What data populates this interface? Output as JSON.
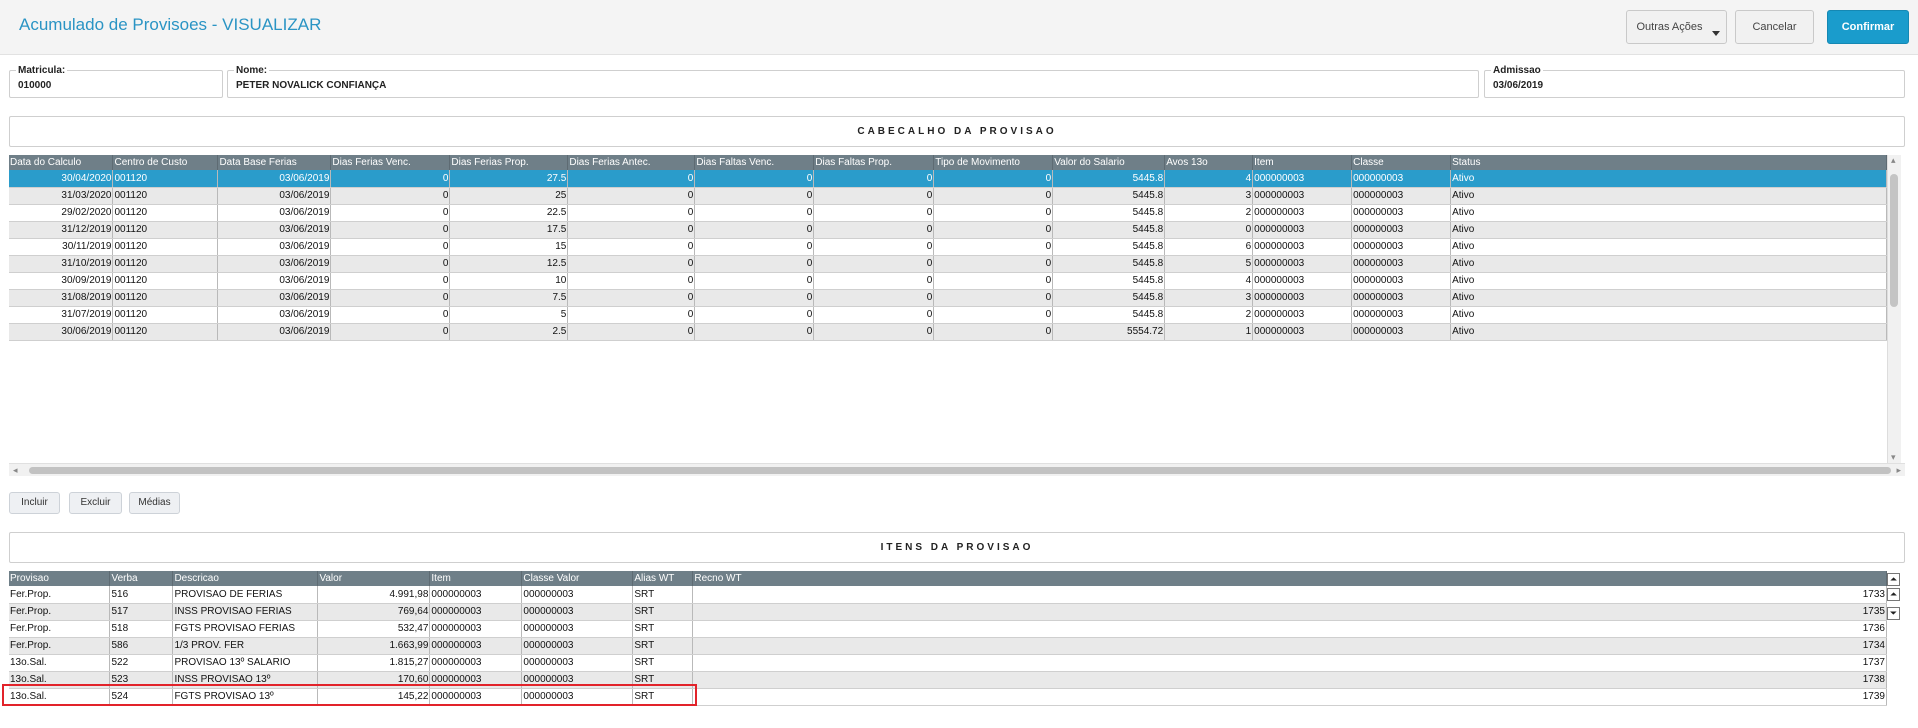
{
  "header": {
    "title": "Acumulado de Provisoes - VISUALIZAR",
    "outras_acoes": "Outras Ações",
    "cancelar": "Cancelar",
    "confirmar": "Confirmar"
  },
  "fields": {
    "matricula_label": "Matricula:",
    "matricula_value": "010000",
    "nome_label": "Nome:",
    "nome_value": "PETER NOVALICK CONFIANÇA",
    "admissao_label": "Admissao",
    "admissao_value": "03/06/2019"
  },
  "cabecalho": {
    "title": "CABECALHO DA PROVISAO",
    "columns": [
      "Data do Calculo",
      "Centro de Custo",
      "Data Base Ferias",
      "Dias Ferias Venc.",
      "Dias Ferias Prop.",
      "Dias Ferias Antec.",
      "Dias Faltas Venc.",
      "Dias Faltas Prop.",
      "Tipo de Movimento",
      "Valor do Salario",
      "Avos 13o",
      "Item",
      "Classe",
      "Status"
    ],
    "rows": [
      [
        "30/04/2020",
        "001120",
        "03/06/2019",
        "0",
        "27.5",
        "0",
        "0",
        "0",
        "0",
        "5445.8",
        "4",
        "000000003",
        "000000003",
        "Ativo"
      ],
      [
        "31/03/2020",
        "001120",
        "03/06/2019",
        "0",
        "25",
        "0",
        "0",
        "0",
        "0",
        "5445.8",
        "3",
        "000000003",
        "000000003",
        "Ativo"
      ],
      [
        "29/02/2020",
        "001120",
        "03/06/2019",
        "0",
        "22.5",
        "0",
        "0",
        "0",
        "0",
        "5445.8",
        "2",
        "000000003",
        "000000003",
        "Ativo"
      ],
      [
        "31/12/2019",
        "001120",
        "03/06/2019",
        "0",
        "17.5",
        "0",
        "0",
        "0",
        "0",
        "5445.8",
        "0",
        "000000003",
        "000000003",
        "Ativo"
      ],
      [
        "30/11/2019",
        "001120",
        "03/06/2019",
        "0",
        "15",
        "0",
        "0",
        "0",
        "0",
        "5445.8",
        "6",
        "000000003",
        "000000003",
        "Ativo"
      ],
      [
        "31/10/2019",
        "001120",
        "03/06/2019",
        "0",
        "12.5",
        "0",
        "0",
        "0",
        "0",
        "5445.8",
        "5",
        "000000003",
        "000000003",
        "Ativo"
      ],
      [
        "30/09/2019",
        "001120",
        "03/06/2019",
        "0",
        "10",
        "0",
        "0",
        "0",
        "0",
        "5445.8",
        "4",
        "000000003",
        "000000003",
        "Ativo"
      ],
      [
        "31/08/2019",
        "001120",
        "03/06/2019",
        "0",
        "7.5",
        "0",
        "0",
        "0",
        "0",
        "5445.8",
        "3",
        "000000003",
        "000000003",
        "Ativo"
      ],
      [
        "31/07/2019",
        "001120",
        "03/06/2019",
        "0",
        "5",
        "0",
        "0",
        "0",
        "0",
        "5445.8",
        "2",
        "000000003",
        "000000003",
        "Ativo"
      ],
      [
        "30/06/2019",
        "001120",
        "03/06/2019",
        "0",
        "2.5",
        "0",
        "0",
        "0",
        "0",
        "5554.72",
        "1",
        "000000003",
        "000000003",
        "Ativo"
      ]
    ]
  },
  "actions": {
    "incluir": "Incluir",
    "excluir": "Excluir",
    "medias": "Médias"
  },
  "itens": {
    "title": "ITENS DA PROVISAO",
    "columns": [
      "Provisao",
      "Verba",
      "Descricao",
      "Valor",
      "Item",
      "Classe Valor",
      "Alias WT",
      "Recno WT"
    ],
    "rows": [
      [
        "Fer.Prop.",
        "516",
        "PROVISAO DE FERIAS",
        "4.991,98",
        "000000003",
        "000000003",
        "SRT",
        "1733"
      ],
      [
        "Fer.Prop.",
        "517",
        "INSS PROVISAO FERIAS",
        "769,64",
        "000000003",
        "000000003",
        "SRT",
        "1735"
      ],
      [
        "Fer.Prop.",
        "518",
        "FGTS PROVISAO FERIAS",
        "532,47",
        "000000003",
        "000000003",
        "SRT",
        "1736"
      ],
      [
        "Fer.Prop.",
        "586",
        "1/3 PROV. FER",
        "1.663,99",
        "000000003",
        "000000003",
        "SRT",
        "1734"
      ],
      [
        "13o.Sal.",
        "522",
        "PROVISAO 13º SALARIO",
        "1.815,27",
        "000000003",
        "000000003",
        "SRT",
        "1737"
      ],
      [
        "13o.Sal.",
        "523",
        "INSS PROVISAO 13º",
        "170,60",
        "000000003",
        "000000003",
        "SRT",
        "1738"
      ],
      [
        "13o.Sal.",
        "524",
        "FGTS PROVISAO 13º",
        "145,22",
        "000000003",
        "000000003",
        "SRT",
        "1739"
      ]
    ]
  },
  "colors": {
    "accent": "#2a94c4",
    "selected_row": "#2a9ccb",
    "grid_header": "#6f7f88",
    "highlight_box": "#e2232a"
  }
}
